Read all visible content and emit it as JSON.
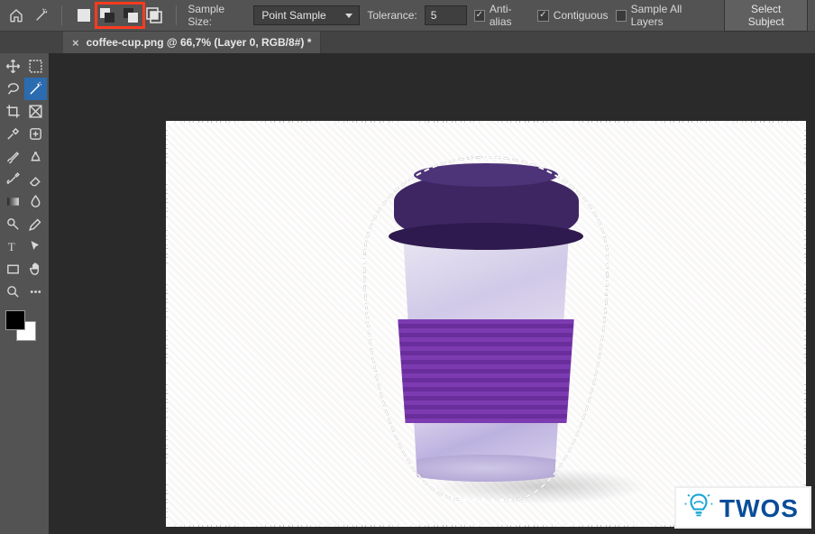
{
  "options_bar": {
    "sample_size_label": "Sample Size:",
    "sample_size_value": "Point Sample",
    "tolerance_label": "Tolerance:",
    "tolerance_value": "5",
    "anti_alias_label": "Anti-alias",
    "anti_alias_checked": true,
    "contiguous_label": "Contiguous",
    "contiguous_checked": true,
    "sample_all_layers_label": "Sample All Layers",
    "sample_all_layers_checked": false,
    "select_subject_label": "Select Subject"
  },
  "tab": {
    "title": "coffee-cup.png @ 66,7% (Layer 0, RGB/8#) *"
  },
  "colors": {
    "highlight": "#ff3b1f",
    "accent": "#2b6bb0",
    "foreground_swatch": "#000000",
    "background_swatch": "#ffffff"
  },
  "watermark": {
    "text": "TWOS"
  }
}
